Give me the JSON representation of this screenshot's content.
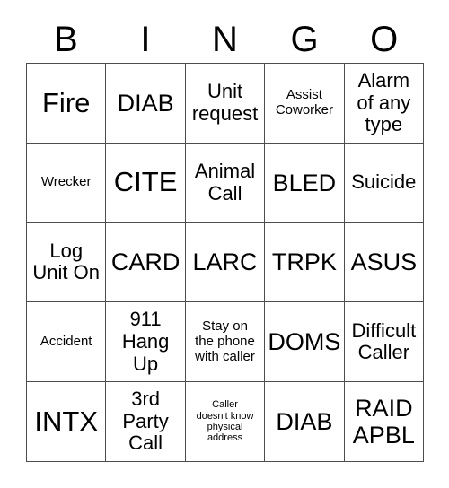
{
  "card": {
    "title": "BINGO",
    "header_letters": [
      "B",
      "I",
      "N",
      "G",
      "O"
    ],
    "border_color": "#4d4d4d",
    "text_color": "#000000",
    "background_color": "#ffffff",
    "rows": [
      [
        {
          "text": "Fire",
          "size": "xl"
        },
        {
          "text": "DIAB",
          "size": "lg"
        },
        {
          "text": "Unit\nrequest",
          "size": "md"
        },
        {
          "text": "Assist\nCoworker",
          "size": "sm"
        },
        {
          "text": "Alarm\nof any\ntype",
          "size": "md"
        }
      ],
      [
        {
          "text": "Wrecker",
          "size": "sm"
        },
        {
          "text": "CITE",
          "size": "xl"
        },
        {
          "text": "Animal\nCall",
          "size": "md"
        },
        {
          "text": "BLED",
          "size": "lg"
        },
        {
          "text": "Suicide",
          "size": "md"
        }
      ],
      [
        {
          "text": "Log\nUnit On",
          "size": "md"
        },
        {
          "text": "CARD",
          "size": "lg"
        },
        {
          "text": "LARC",
          "size": "lg"
        },
        {
          "text": "TRPK",
          "size": "lg"
        },
        {
          "text": "ASUS",
          "size": "lg"
        }
      ],
      [
        {
          "text": "Accident",
          "size": "sm"
        },
        {
          "text": "911\nHang\nUp",
          "size": "md"
        },
        {
          "text": "Stay on\nthe phone\nwith caller",
          "size": "sm"
        },
        {
          "text": "DOMS",
          "size": "lg"
        },
        {
          "text": "Difficult\nCaller",
          "size": "md"
        }
      ],
      [
        {
          "text": "INTX",
          "size": "xl"
        },
        {
          "text": "3rd\nParty\nCall",
          "size": "md"
        },
        {
          "text": "Caller\ndoesn't know\nphysical\naddress",
          "size": "xs"
        },
        {
          "text": "DIAB",
          "size": "lg"
        },
        {
          "text": "RAID\nAPBL",
          "size": "lg"
        }
      ]
    ]
  }
}
